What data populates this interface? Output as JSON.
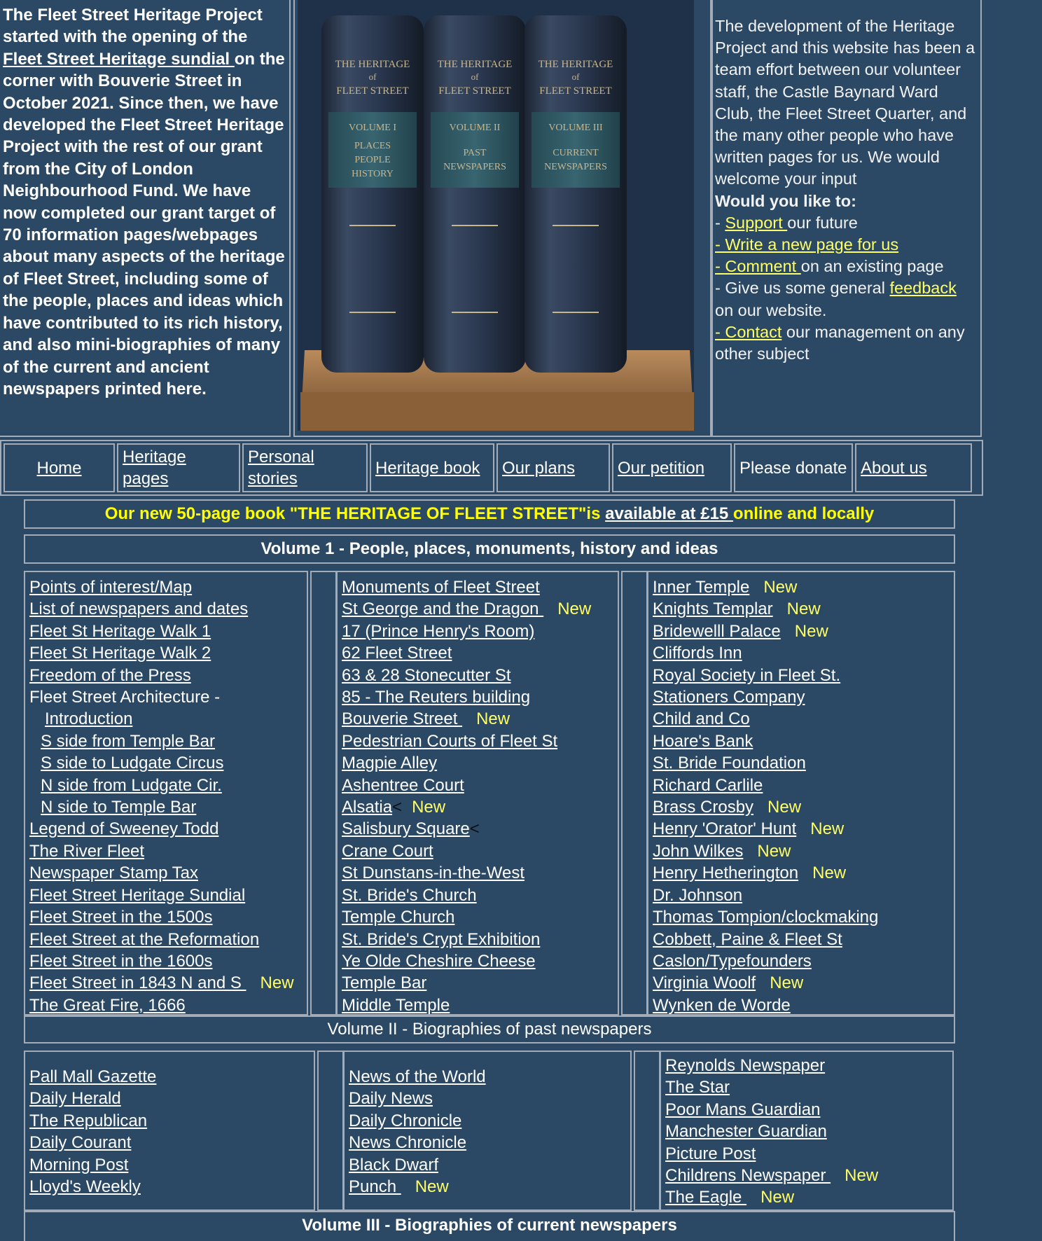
{
  "intro": {
    "text_a": "The Fleet Street Heritage Project started with the opening of the ",
    "sundial_link": "Fleet Street Heritage sundial ",
    "text_b": "on the corner with Bouverie Street in October 2021. Since then, we have developed the Fleet Street Heritage Project with the rest of our grant from the City of London Neighbourhood Fund. We have now completed our grant target of 70 information pages/webpages about many aspects of the heritage of Fleet Street, including some of the people, places and ideas which have contributed to its rich history, and also mini-biographies of many of the current and ancient newspapers printed here."
  },
  "books": {
    "volumes": [
      {
        "title_line1": "THE HERITAGE",
        "title_of": "of",
        "title_line2": "FLEET STREET",
        "vol": "VOLUME I",
        "sub": [
          "PLACES",
          "PEOPLE",
          "HISTORY"
        ]
      },
      {
        "title_line1": "THE HERITAGE",
        "title_of": "of",
        "title_line2": "FLEET STREET",
        "vol": "VOLUME II",
        "sub": [
          "PAST",
          "NEWSPAPERS"
        ]
      },
      {
        "title_line1": "THE HERITAGE",
        "title_of": "of",
        "title_line2": "FLEET STREET",
        "vol": "VOLUME III",
        "sub": [
          "CURRENT",
          "NEWSPAPERS"
        ]
      }
    ]
  },
  "right": {
    "text": "The development of the Heritage Project and this website has been a team effort between our volunteer staff, the Castle Baynard Ward Club, the Fleet Street Quarter, and the many other people who have written pages for us. We would welcome your input",
    "question": "Would you like to:",
    "support_prefix": "- ",
    "support_link": "Support ",
    "support_suffix": "our future",
    "write_link": "- Write a new page for us",
    "comment_link": "- Comment ",
    "comment_suffix": "on an existing page",
    "feedback_prefix": "- Give us some general ",
    "feedback_link": "feedback",
    "feedback_suffix": "on our website.",
    "contact_link": "- Contact",
    "contact_suffix": " our management on any other subject"
  },
  "nav": {
    "home": "Home",
    "heritage_pages": "Heritage pages",
    "personal_stories": "Personal stories",
    "heritage_book": "Heritage book",
    "our_plans": "Our plans",
    "our_petition": "Our petition",
    "please_donate": "Please donate",
    "about_us": "About us"
  },
  "book_banner": {
    "prefix": "Our new 50-page book \"THE HERITAGE OF FLEET STREET\"is ",
    "link": "available at £15 ",
    "suffix": "online and locally"
  },
  "vol1": {
    "title": "Volume 1 - People, places, monuments, history and ideas",
    "col1": [
      {
        "label": "Points of interest/Map",
        "new": ""
      },
      {
        "label": "List of newspapers and dates",
        "new": ""
      },
      {
        "label": "Fleet St Heritage Walk 1",
        "new": ""
      },
      {
        "label": "Fleet St Heritage Walk 2",
        "new": ""
      },
      {
        "label": "Freedom of the Press ",
        "new": ""
      },
      {
        "label": "Fleet Street Architecture -",
        "new": "",
        "plain": true
      },
      {
        "label": "Introduction ",
        "new": "",
        "indent": 22
      },
      {
        "label": " S side from Temple Bar ",
        "new": "",
        "indent": 16
      },
      {
        "label": "S side to Ludgate Circus ",
        "new": "",
        "indent": 16
      },
      {
        "label": "N side from Ludgate Cir.",
        "new": "",
        "indent": 16
      },
      {
        "label": "N side to Temple Bar",
        "new": "",
        "indent": 16
      },
      {
        "label": "Legend of Sweeney Todd ",
        "new": ""
      },
      {
        "label": "The River Fleet ",
        "new": ""
      },
      {
        "label": "Newspaper Stamp Tax",
        "new": ""
      },
      {
        "label": "Fleet Street Heritage Sundial",
        "new": ""
      },
      {
        "label": "Fleet Street in the 1500s",
        "new": ""
      },
      {
        "label": "Fleet Street at the Reformation",
        "new": ""
      },
      {
        "label": "Fleet Street in the 1600s ",
        "new": ""
      },
      {
        "label": "Fleet Street in 1843 N and S ",
        "new": "New"
      },
      {
        "label": "The Great Fire, 1666",
        "new": ""
      }
    ],
    "col2": [
      {
        "label": "Monuments of Fleet Street ",
        "new": ""
      },
      {
        "label": "St George and the Dragon ",
        "new": "New"
      },
      {
        "label": "17 (Prince Henry's Room)",
        "new": ""
      },
      {
        "label": "62 Fleet Street",
        "new": ""
      },
      {
        "label": "63 & 28 Stonecutter St",
        "new": ""
      },
      {
        "label": "85 - The Reuters building ",
        "new": ""
      },
      {
        "label": "Bouverie Street ",
        "new": "New"
      },
      {
        "label": "Pedestrian Courts of Fleet St",
        "new": ""
      },
      {
        "label": "Magpie Alley",
        "new": ""
      },
      {
        "label": "Ashentree Court",
        "new": ""
      },
      {
        "label": "Alsatia",
        "new": "New",
        "lt": "<"
      },
      {
        "label": "Salisbury Square",
        "new": "",
        "lt": "<"
      },
      {
        "label": "Crane Court",
        "new": ""
      },
      {
        "label": "St Dunstans-in-the-West",
        "new": ""
      },
      {
        "label": "St. Bride's Church ",
        "new": ""
      },
      {
        "label": "Temple Church",
        "new": ""
      },
      {
        "label": "St. Bride's Crypt Exhibition ",
        "new": ""
      },
      {
        "label": "Ye Olde Cheshire Cheese",
        "new": ""
      },
      {
        "label": "Temple Bar",
        "new": ""
      },
      {
        "label": "Middle Temple",
        "new": ""
      }
    ],
    "col3": [
      {
        "label": "Inner Temple",
        "new": "New"
      },
      {
        "label": "Knights Templar",
        "new": "New"
      },
      {
        "label": "Bridewelll Palace",
        "new": "New"
      },
      {
        "label": "Cliffords Inn",
        "new": ""
      },
      {
        "label": "Royal Society in Fleet St.",
        "new": ""
      },
      {
        "label": "Stationers Company",
        "new": ""
      },
      {
        "label": "Child and Co",
        "new": ""
      },
      {
        "label": "Hoare's Bank",
        "new": ""
      },
      {
        "label": "St. Bride Foundation",
        "new": ""
      },
      {
        "label": "Richard Carlile",
        "new": ""
      },
      {
        "label": "Brass Crosby",
        "new": "New"
      },
      {
        "label": "Henry 'Orator' Hunt",
        "new": "New"
      },
      {
        "label": "John Wilkes",
        "new": "New"
      },
      {
        "label": "Henry Hetherington",
        "new": "New"
      },
      {
        "label": "Dr. Johnson",
        "new": ""
      },
      {
        "label": "Thomas Tompion/clockmaking",
        "new": ""
      },
      {
        "label": "Cobbett, Paine & Fleet St",
        "new": ""
      },
      {
        "label": "Caslon/Typefounders",
        "new": ""
      },
      {
        "label": "Virginia Woolf",
        "new": "New"
      },
      {
        "label": "Wynken de Worde",
        "new": ""
      }
    ]
  },
  "vol2": {
    "title": "Volume II - Biographies of past newspapers",
    "col1": [
      {
        "label": "Pall Mall Gazette ",
        "new": ""
      },
      {
        "label": "Daily Herald",
        "new": ""
      },
      {
        "label": "The Republican ",
        "new": ""
      },
      {
        "label": "Daily Courant ",
        "new": ""
      },
      {
        "label": "Morning Post ",
        "new": ""
      },
      {
        "label": "Lloyd's Weekly",
        "new": ""
      }
    ],
    "col2": [
      {
        "label": "News of the World ",
        "new": ""
      },
      {
        "label": "Daily News ",
        "new": ""
      },
      {
        "label": "Daily Chronicle ",
        "new": ""
      },
      {
        "label": "News Chronicle ",
        "new": ""
      },
      {
        "label": "Black Dwarf ",
        "new": ""
      },
      {
        "label": "Punch ",
        "new": "New"
      }
    ],
    "col3": [
      {
        "label": "Reynolds Newspaper ",
        "new": ""
      },
      {
        "label": "The Star ",
        "new": ""
      },
      {
        "label": "Poor Mans Guardian ",
        "new": ""
      },
      {
        "label": "Manchester Guardian ",
        "new": ""
      },
      {
        "label": "Picture Post",
        "new": ""
      },
      {
        "label": "Childrens Newspaper ",
        "new": "New"
      },
      {
        "label": "The Eagle ",
        "new": "New"
      }
    ]
  },
  "vol3": {
    "title": "Volume III - Biographies of current newspapers"
  }
}
